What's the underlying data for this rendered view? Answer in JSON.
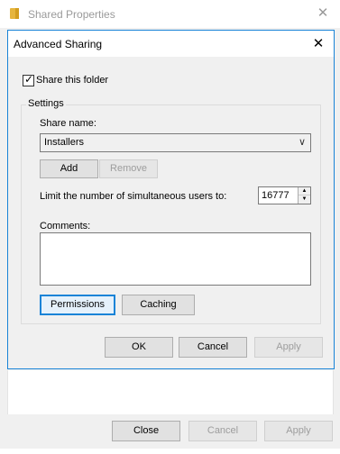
{
  "outer_window": {
    "title": "Shared Properties",
    "close_glyph": "✕",
    "buttons": {
      "close_label": "Close",
      "cancel_label": "Cancel",
      "apply_label": "Apply"
    }
  },
  "dialog": {
    "title": "Advanced Sharing",
    "close_glyph": "✕",
    "share_checkbox": {
      "label": "Share this folder",
      "checked": true
    },
    "settings": {
      "legend": "Settings",
      "share_name_label": "Share name:",
      "share_name_value": "Installers",
      "dropdown_glyph": "∨",
      "add_label": "Add",
      "remove_label": "Remove",
      "limit_label": "Limit the number of simultaneous users to:",
      "limit_value": "16777",
      "spin_up_glyph": "▲",
      "spin_down_glyph": "▼",
      "comments_label": "Comments:",
      "comments_value": "",
      "permissions_label": "Permissions",
      "caching_label": "Caching"
    },
    "buttons": {
      "ok_label": "OK",
      "cancel_label": "Cancel",
      "apply_label": "Apply"
    }
  },
  "icons": {
    "folder": "folder-icon",
    "close": "close-icon",
    "dropdown": "chevron-down-icon"
  },
  "colors": {
    "accent": "#1883d7",
    "folder": "#e6b53d",
    "disabled_text": "#9d9d9d"
  }
}
